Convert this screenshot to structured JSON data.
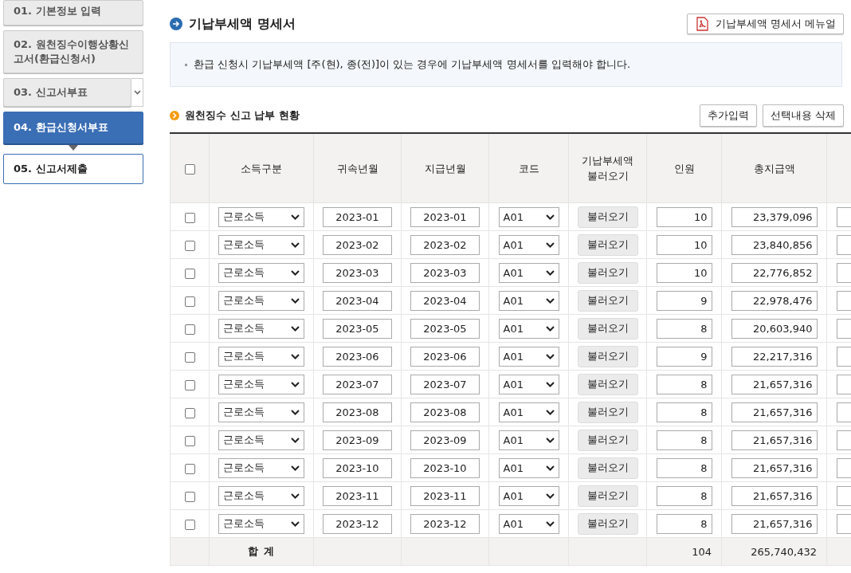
{
  "sidebar": {
    "items": [
      {
        "label": "01. 기본정보 입력",
        "selected": false,
        "done": true,
        "expandable": false
      },
      {
        "label": "02. 원천징수이행상황신고서(환급신청서)",
        "selected": false,
        "done": true,
        "expandable": false
      },
      {
        "label": "03. 신고서부표",
        "selected": false,
        "done": true,
        "expandable": true
      },
      {
        "label": "04. 환급신청서부표",
        "selected": true,
        "done": true,
        "expandable": false
      },
      {
        "label": "05. 신고서제출",
        "selected": false,
        "done": false,
        "expandable": false
      }
    ]
  },
  "page": {
    "title": "기납부세액 명세서",
    "manual_button": "기납부세액 명세서 메뉴얼",
    "notice": "환급 신청시 기납부세액 [주(현), 종(전)]이 있는 경우에 기납부세액 명세서를 입력해야 합니다."
  },
  "section": {
    "title": "원천징수 신고 납부 현황",
    "buttons": [
      "추가입력",
      "선택내용 삭제"
    ]
  },
  "table": {
    "all_checked": false,
    "columns": [
      "소득구분",
      "귀속년월",
      "지급년월",
      "코드",
      "기납부세액\n불러오기",
      "인원",
      "총지급액"
    ],
    "rows": [
      {
        "checked": false,
        "income_type": "근로소득",
        "attribution_month": "2023-01",
        "payment_month": "2023-01",
        "code": "A01",
        "load_button": "불러오기",
        "headcount": "10",
        "total_paid": "23,379,096"
      },
      {
        "checked": false,
        "income_type": "근로소득",
        "attribution_month": "2023-02",
        "payment_month": "2023-02",
        "code": "A01",
        "load_button": "불러오기",
        "headcount": "10",
        "total_paid": "23,840,856"
      },
      {
        "checked": false,
        "income_type": "근로소득",
        "attribution_month": "2023-03",
        "payment_month": "2023-03",
        "code": "A01",
        "load_button": "불러오기",
        "headcount": "10",
        "total_paid": "22,776,852"
      },
      {
        "checked": false,
        "income_type": "근로소득",
        "attribution_month": "2023-04",
        "payment_month": "2023-04",
        "code": "A01",
        "load_button": "불러오기",
        "headcount": "9",
        "total_paid": "22,978,476"
      },
      {
        "checked": false,
        "income_type": "근로소득",
        "attribution_month": "2023-05",
        "payment_month": "2023-05",
        "code": "A01",
        "load_button": "불러오기",
        "headcount": "8",
        "total_paid": "20,603,940"
      },
      {
        "checked": false,
        "income_type": "근로소득",
        "attribution_month": "2023-06",
        "payment_month": "2023-06",
        "code": "A01",
        "load_button": "불러오기",
        "headcount": "9",
        "total_paid": "22,217,316"
      },
      {
        "checked": false,
        "income_type": "근로소득",
        "attribution_month": "2023-07",
        "payment_month": "2023-07",
        "code": "A01",
        "load_button": "불러오기",
        "headcount": "8",
        "total_paid": "21,657,316"
      },
      {
        "checked": false,
        "income_type": "근로소득",
        "attribution_month": "2023-08",
        "payment_month": "2023-08",
        "code": "A01",
        "load_button": "불러오기",
        "headcount": "8",
        "total_paid": "21,657,316"
      },
      {
        "checked": false,
        "income_type": "근로소득",
        "attribution_month": "2023-09",
        "payment_month": "2023-09",
        "code": "A01",
        "load_button": "불러오기",
        "headcount": "8",
        "total_paid": "21,657,316"
      },
      {
        "checked": false,
        "income_type": "근로소득",
        "attribution_month": "2023-10",
        "payment_month": "2023-10",
        "code": "A01",
        "load_button": "불러오기",
        "headcount": "8",
        "total_paid": "21,657,316"
      },
      {
        "checked": false,
        "income_type": "근로소득",
        "attribution_month": "2023-11",
        "payment_month": "2023-11",
        "code": "A01",
        "load_button": "불러오기",
        "headcount": "8",
        "total_paid": "21,657,316"
      },
      {
        "checked": false,
        "income_type": "근로소득",
        "attribution_month": "2023-12",
        "payment_month": "2023-12",
        "code": "A01",
        "load_button": "불러오기",
        "headcount": "8",
        "total_paid": "21,657,316"
      }
    ],
    "total": {
      "label": "합 계",
      "headcount": "104",
      "total_paid": "265,740,432"
    }
  }
}
